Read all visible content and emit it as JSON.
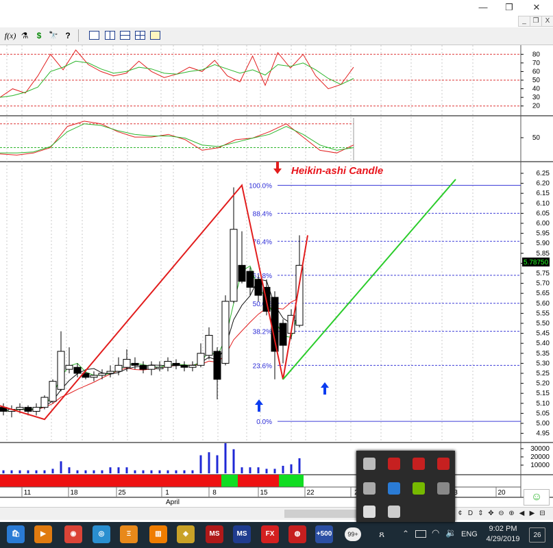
{
  "window": {
    "minimize_glyph": "—",
    "maximize_glyph": "❐",
    "close_glyph": "✕",
    "mdi_minimize_glyph": "_",
    "mdi_restore_glyph": "❐",
    "mdi_close_glyph": "X"
  },
  "toolbar": {
    "items": [
      {
        "name": "function-tool",
        "label": "f(x)"
      },
      {
        "name": "indicator-tool",
        "label": "⚗"
      },
      {
        "name": "dollar-tool",
        "label": "$"
      },
      {
        "name": "binoculars-tool",
        "label": "🔭"
      },
      {
        "name": "help-tool",
        "label": "?"
      }
    ]
  },
  "stochastic_panel": {
    "axis_ticks": [
      "80",
      "70",
      "60",
      "50",
      "40",
      "30",
      "20"
    ]
  },
  "second_panel": {
    "axis_ticks": [
      "50"
    ]
  },
  "price_panel": {
    "annotation": "Heikin-ashi Candle",
    "price_ticks": [
      "6.25",
      "6.20",
      "6.15",
      "6.10",
      "6.05",
      "6.00",
      "5.95",
      "5.90",
      "5.85",
      "5.80",
      "5.75",
      "5.70",
      "5.65",
      "5.60",
      "5.55",
      "5.50",
      "5.45",
      "5.40",
      "5.35",
      "5.30",
      "5.25",
      "5.20",
      "5.15",
      "5.10",
      "5.05",
      "5.00",
      "4.95"
    ],
    "last_price": "5.78750",
    "fib_levels": [
      {
        "label": "100.0%",
        "price": 6.19
      },
      {
        "label": "88.4%",
        "price": 6.05
      },
      {
        "label": "76.4%",
        "price": 5.91
      },
      {
        "label": "61.8%",
        "price": 5.74
      },
      {
        "label": "50.0%",
        "price": 5.6
      },
      {
        "label": "38.2%",
        "price": 5.46
      },
      {
        "label": "23.6%",
        "price": 5.29
      },
      {
        "label": "0.0%",
        "price": 5.01
      }
    ]
  },
  "volume_panel": {
    "axis_ticks": [
      "30000",
      "20000",
      "10000"
    ]
  },
  "time_axis": {
    "labels": [
      "11",
      "18",
      "25",
      "1",
      "8",
      "15",
      "22",
      "2",
      "3",
      "20"
    ],
    "month_label": "April"
  },
  "chart_data": {
    "type": "candlestick",
    "candles": [
      {
        "o": 5.08,
        "h": 5.1,
        "l": 5.04,
        "c": 5.06
      },
      {
        "o": 5.06,
        "h": 5.09,
        "l": 5.03,
        "c": 5.07
      },
      {
        "o": 5.07,
        "h": 5.1,
        "l": 5.05,
        "c": 5.08
      },
      {
        "o": 5.08,
        "h": 5.09,
        "l": 5.04,
        "c": 5.06
      },
      {
        "o": 5.06,
        "h": 5.1,
        "l": 5.04,
        "c": 5.08
      },
      {
        "o": 5.08,
        "h": 5.14,
        "l": 5.07,
        "c": 5.13
      },
      {
        "o": 5.11,
        "h": 5.22,
        "l": 5.1,
        "c": 5.21
      },
      {
        "o": 5.17,
        "h": 5.46,
        "l": 5.16,
        "c": 5.36
      },
      {
        "o": 5.27,
        "h": 5.38,
        "l": 5.25,
        "c": 5.29
      },
      {
        "o": 5.28,
        "h": 5.3,
        "l": 5.23,
        "c": 5.25
      },
      {
        "o": 5.25,
        "h": 5.27,
        "l": 5.22,
        "c": 5.23
      },
      {
        "o": 5.23,
        "h": 5.26,
        "l": 5.21,
        "c": 5.24
      },
      {
        "o": 5.24,
        "h": 5.27,
        "l": 5.22,
        "c": 5.25
      },
      {
        "o": 5.25,
        "h": 5.29,
        "l": 5.23,
        "c": 5.26
      },
      {
        "o": 5.26,
        "h": 5.33,
        "l": 5.24,
        "c": 5.29
      },
      {
        "o": 5.28,
        "h": 5.37,
        "l": 5.26,
        "c": 5.32
      },
      {
        "o": 5.3,
        "h": 5.33,
        "l": 5.27,
        "c": 5.29
      },
      {
        "o": 5.29,
        "h": 5.31,
        "l": 5.25,
        "c": 5.27
      },
      {
        "o": 5.27,
        "h": 5.31,
        "l": 5.24,
        "c": 5.29
      },
      {
        "o": 5.28,
        "h": 5.31,
        "l": 5.26,
        "c": 5.28
      },
      {
        "o": 5.28,
        "h": 5.33,
        "l": 5.26,
        "c": 5.31
      },
      {
        "o": 5.3,
        "h": 5.32,
        "l": 5.27,
        "c": 5.29
      },
      {
        "o": 5.29,
        "h": 5.31,
        "l": 5.26,
        "c": 5.28
      },
      {
        "o": 5.28,
        "h": 5.31,
        "l": 5.26,
        "c": 5.29
      },
      {
        "o": 5.29,
        "h": 5.4,
        "l": 5.28,
        "c": 5.35
      },
      {
        "o": 5.34,
        "h": 5.48,
        "l": 5.32,
        "c": 5.44
      },
      {
        "o": 5.36,
        "h": 5.38,
        "l": 5.12,
        "c": 5.22
      },
      {
        "o": 5.3,
        "h": 5.64,
        "l": 5.29,
        "c": 5.61
      },
      {
        "o": 5.61,
        "h": 6.18,
        "l": 5.6,
        "c": 5.97
      },
      {
        "o": 5.79,
        "h": 5.96,
        "l": 5.7,
        "c": 5.71
      },
      {
        "o": 5.76,
        "h": 5.78,
        "l": 5.64,
        "c": 5.68
      },
      {
        "o": 5.72,
        "h": 5.74,
        "l": 5.61,
        "c": 5.64
      },
      {
        "o": 5.68,
        "h": 5.72,
        "l": 5.54,
        "c": 5.56
      },
      {
        "o": 5.63,
        "h": 5.66,
        "l": 5.22,
        "c": 5.36
      },
      {
        "o": 5.5,
        "h": 5.52,
        "l": 5.3,
        "c": 5.39
      },
      {
        "o": 5.45,
        "h": 5.57,
        "l": 5.42,
        "c": 5.54
      },
      {
        "o": 5.49,
        "h": 5.94,
        "l": 5.48,
        "c": 5.79
      }
    ],
    "volume": [
      2,
      2,
      2,
      2,
      2,
      2,
      3,
      8,
      4,
      2,
      2,
      2,
      2,
      4,
      4,
      4,
      2,
      2,
      2,
      2,
      2,
      2,
      2,
      2,
      12,
      14,
      12,
      20,
      16,
      4,
      4,
      4,
      3,
      3,
      5,
      6,
      10
    ],
    "trend_bar": [
      "red",
      "red",
      "red",
      "red",
      "red",
      "red",
      "red",
      "red",
      "red",
      "red",
      "red",
      "red",
      "red",
      "red",
      "red",
      "red",
      "red",
      "red",
      "red",
      "red",
      "red",
      "red",
      "red",
      "red",
      "red",
      "red",
      "red",
      "green",
      "green",
      "red",
      "red",
      "red",
      "red",
      "red",
      "green",
      "green",
      "green"
    ],
    "zigzag": [
      [
        -3,
        5.12
      ],
      [
        5,
        5.02
      ],
      [
        29,
        6.19
      ],
      [
        34,
        5.22
      ],
      [
        37,
        5.94
      ]
    ],
    "projection": [
      [
        34,
        5.22
      ],
      [
        55,
        6.22
      ]
    ],
    "stoch_k": [
      30,
      40,
      35,
      55,
      80,
      62,
      85,
      68,
      60,
      55,
      58,
      72,
      60,
      53,
      57,
      65,
      60,
      73,
      55,
      48,
      78,
      44,
      82,
      64,
      80,
      55,
      40,
      45,
      65
    ],
    "stoch_d": [
      30,
      32,
      36,
      42,
      60,
      65,
      72,
      70,
      63,
      58,
      60,
      65,
      63,
      58,
      57,
      60,
      62,
      68,
      63,
      58,
      62,
      56,
      68,
      66,
      70,
      62,
      52,
      45,
      52
    ],
    "second_k": [
      28,
      26,
      30,
      40,
      80,
      90,
      85,
      70,
      60,
      60,
      65,
      55,
      35,
      40,
      55,
      58,
      70,
      85,
      60,
      35,
      30,
      45
    ],
    "second_d": [
      30,
      30,
      32,
      42,
      70,
      85,
      82,
      72,
      65,
      62,
      62,
      58,
      45,
      42,
      50,
      58,
      65,
      80,
      65,
      45,
      35,
      40
    ]
  },
  "taskbar": {
    "language": "ENG",
    "time": "9:02 PM",
    "date": "4/29/2019",
    "notifications": "26",
    "badge_count": "99+",
    "apps": [
      {
        "name": "store",
        "label": "🛍",
        "color": "#2a7bd5"
      },
      {
        "name": "media",
        "label": "▶",
        "color": "#e07b10"
      },
      {
        "name": "chrome",
        "label": "◉",
        "color": "#db4437"
      },
      {
        "name": "app-blue",
        "label": "◎",
        "color": "#2a8fd0"
      },
      {
        "name": "app-orange",
        "label": "Ξ",
        "color": "#e8891a"
      },
      {
        "name": "app-chart",
        "label": "▥",
        "color": "#ef7d00"
      },
      {
        "name": "app-5",
        "label": "◈",
        "color": "#c9a227"
      },
      {
        "name": "app-ms",
        "label": "MS",
        "color": "#b01919"
      },
      {
        "name": "app-ms2",
        "label": "MS",
        "color": "#1f3c8f"
      },
      {
        "name": "fxpro",
        "label": "FX",
        "color": "#d42020"
      },
      {
        "name": "app-red",
        "label": "◍",
        "color": "#c61f1f"
      },
      {
        "name": "app-500",
        "label": "+500",
        "color": "#2b4fa3"
      }
    ]
  },
  "tray_popup": {
    "icons": [
      "bracket",
      "ms-red",
      "ms-red2",
      "ms-red3",
      "diamond",
      "globe",
      "nvidia",
      "cloud",
      "shield",
      "c-logo"
    ]
  },
  "hscroll": {
    "buttons": [
      "¢",
      "D",
      "⇕",
      "✥",
      "⊖",
      "⊕",
      "◀",
      "▶",
      "⊟"
    ]
  },
  "status_smiley": "☺"
}
